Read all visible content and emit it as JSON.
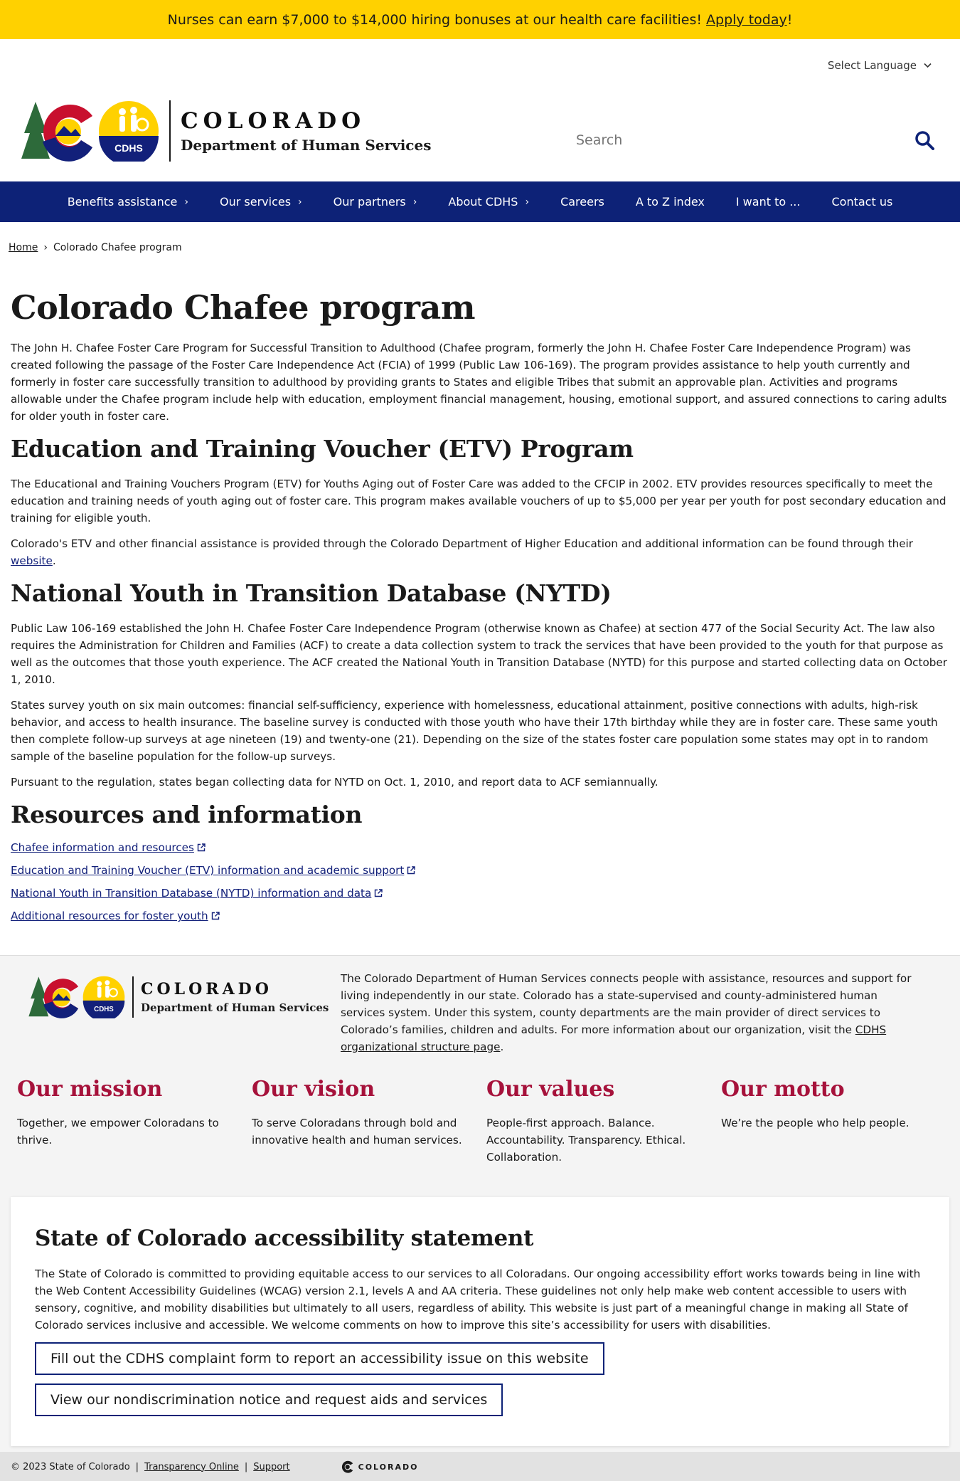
{
  "banner": {
    "text": "Nurses can earn $7,000 to $14,000 hiring bonuses at our health care facilities!",
    "link": "Apply today",
    "tail": "!"
  },
  "header": {
    "language": "Select Language",
    "logo_title": "COLORADO",
    "logo_subtitle": "Department of Human Services",
    "logo_badge": "CDHS",
    "search_placeholder": "Search"
  },
  "nav": [
    {
      "label": "Benefits assistance",
      "arrow": "›"
    },
    {
      "label": "Our services",
      "arrow": "›"
    },
    {
      "label": "Our partners",
      "arrow": "›"
    },
    {
      "label": "About CDHS",
      "arrow": "›"
    },
    {
      "label": "Careers",
      "arrow": ""
    },
    {
      "label": "A to Z index",
      "arrow": ""
    },
    {
      "label": "I want to ...",
      "arrow": ""
    },
    {
      "label": "Contact us",
      "arrow": ""
    }
  ],
  "breadcrumb": {
    "home": "Home",
    "sep": "›",
    "current": "Colorado Chafee program"
  },
  "main": {
    "title": "Colorado Chafee program",
    "intro": "The John H. Chafee Foster Care Program for Successful Transition to Adulthood (Chafee program, formerly the John H. Chafee Foster Care Independence Program) was created following the passage of the Foster Care Independence Act (FCIA) of 1999 (Public Law 106-169). The program provides assistance to help youth currently and formerly in foster care successfully transition to adulthood by providing grants to States and eligible Tribes that submit an approvable plan. Activities and programs allowable under the Chafee program include help with education, employment financial management, housing, emotional support, and assured connections to caring adults for older youth in foster care.",
    "etv_heading": "Education and Training Voucher (ETV) Program",
    "etv_p1": "The Educational and Training Vouchers Program (ETV) for Youths Aging out of Foster Care was added to the CFCIP in 2002. ETV provides resources specifically to meet the education and training needs of youth aging out of foster care. This program makes available vouchers of up to $5,000 per year per youth for post secondary education and training for eligible youth.",
    "etv_p2": "Colorado's ETV and other financial assistance is provided through the Colorado Department of Higher Education and additional information can be found through their",
    "etv_p2_link": "website",
    "etv_p2_tail": ".",
    "nytd_heading": "National Youth in Transition Database (NYTD)",
    "nytd_p1": "Public Law 106-169 established the John H. Chafee Foster Care Independence Program (otherwise known as Chafee) at section 477 of the Social Security Act. The law also requires the Administration for Children and Families (ACF) to create a data collection system to track the services that have been provided to the youth for that purpose as well as the outcomes that those youth experience. The ACF created the National Youth in Transition Database (NYTD) for this purpose and started collecting data on October 1, 2010.",
    "nytd_p2": "States survey youth on six main outcomes: financial self-sufficiency, experience with homelessness, educational attainment, positive connections with adults, high-risk behavior, and access to health insurance. The baseline survey is conducted with those youth who have their 17th birthday while they are in foster care. These same youth then complete follow-up surveys at age nineteen (19) and twenty-one (21). Depending on the size of the states foster care population some states may opt in to random sample of the baseline population for the follow-up surveys.",
    "nytd_p3": "Pursuant to the regulation, states began collecting data for NYTD on Oct. 1, 2010, and report data to ACF semiannually.",
    "res_heading": "Resources and information",
    "resources": [
      "Chafee information and resources",
      "Education and Training Voucher (ETV) information and academic support",
      "National Youth in Transition Database (NYTD) information and data",
      "Additional resources for foster youth"
    ]
  },
  "footer": {
    "about": "The Colorado Department of Human Services connects people with assistance, resources and support for living independently in our state. Colorado has a state-supervised and county-administered human services system. Under this system, county departments are the main provider of direct services to Colorado’s families, children and adults. For more information about our organization, visit the",
    "about_link": "CDHS organizational structure page",
    "about_tail": ".",
    "pillars": [
      {
        "title": "Our mission",
        "text": "Together, we empower Coloradans to thrive."
      },
      {
        "title": "Our vision",
        "text": "To serve Coloradans through bold and innovative health and human services."
      },
      {
        "title": "Our values",
        "text": "People-first approach. Balance. Accountability. Transparency. Ethical. Collaboration."
      },
      {
        "title": "Our motto",
        "text": "We’re the people who help people."
      }
    ],
    "a11y_title": "State of Colorado accessibility statement",
    "a11y_text": "The State of Colorado is committed to providing equitable access to our services to all Coloradans. Our ongoing accessibility effort works towards being in line with the Web Content Accessibility Guidelines (WCAG) version 2.1, levels A and AA criteria. These guidelines not only help make web content accessible to users with sensory, cognitive, and mobility disabilities but ultimately to all users, regardless of ability. This website is just part of a meaningful change in making all State of Colorado services inclusive and accessible. We welcome comments on how to improve this site’s accessibility for users with disabilities.",
    "a11y_btn1": "Fill out the CDHS complaint form to report an accessibility issue on this website",
    "a11y_btn2": "View our nondiscrimination notice and request aids and services",
    "copyright": "© 2023 State of Colorado",
    "sep": "|",
    "transparency": "Transparency Online",
    "support": "Support",
    "mini_logo": "COLORADO"
  },
  "colors": {
    "banner": "#ffd100",
    "nav": "#0d2277",
    "pillar_title": "#a6123b"
  }
}
